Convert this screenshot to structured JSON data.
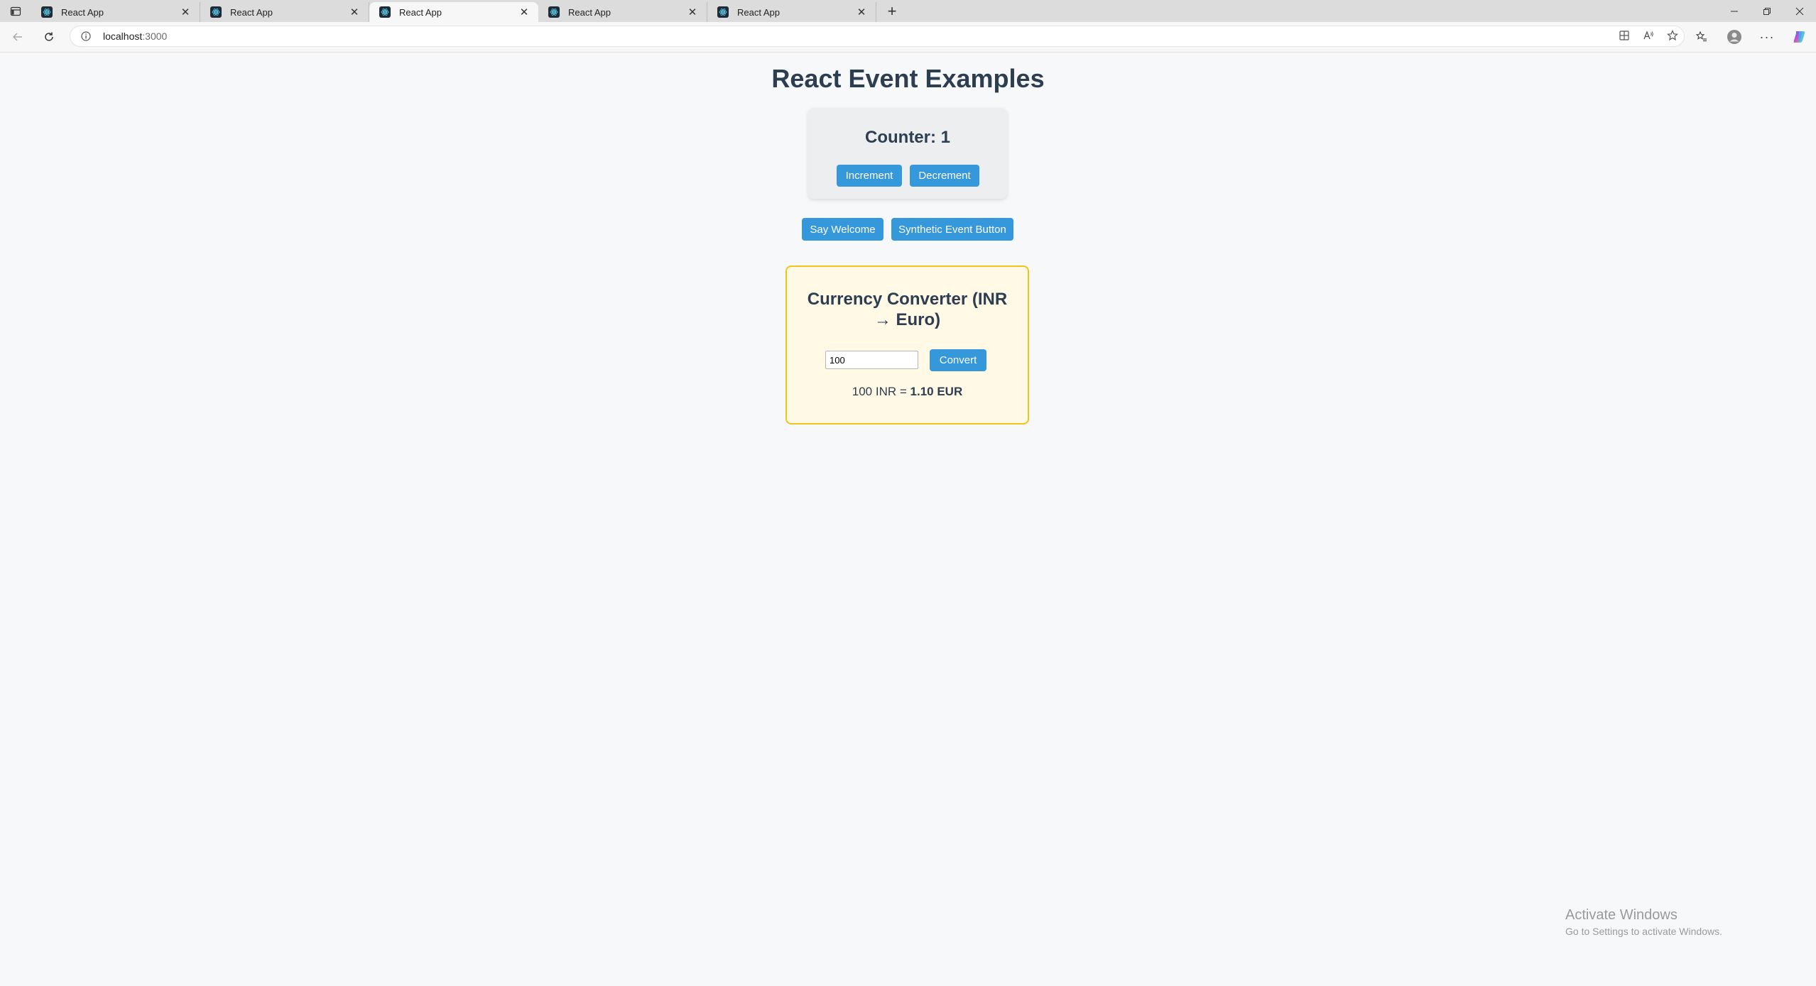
{
  "browser": {
    "tabs": [
      {
        "title": "React App",
        "active": false
      },
      {
        "title": "React App",
        "active": false
      },
      {
        "title": "React App",
        "active": true
      },
      {
        "title": "React App",
        "active": false
      },
      {
        "title": "React App",
        "active": false
      }
    ],
    "url_host": "localhost",
    "url_port": ":3000"
  },
  "page": {
    "title": "React Event Examples",
    "counter": {
      "label": "Counter: 1",
      "increment_label": "Increment",
      "decrement_label": "Decrement"
    },
    "say_welcome_label": "Say Welcome",
    "synthetic_label": "Synthetic Event Button",
    "currency": {
      "title_line1": "Currency Converter (INR",
      "title_line2": "→ Euro)",
      "amount_value": "100",
      "convert_label": "Convert",
      "result_prefix": "100 INR = ",
      "result_value": "1.10 EUR"
    }
  },
  "watermark": {
    "line1": "Activate Windows",
    "line2": "Go to Settings to activate Windows."
  },
  "colors": {
    "button": "#3498db",
    "heading": "#2c3e50",
    "currency_border": "#f0c419",
    "currency_bg": "#fff9e6"
  }
}
